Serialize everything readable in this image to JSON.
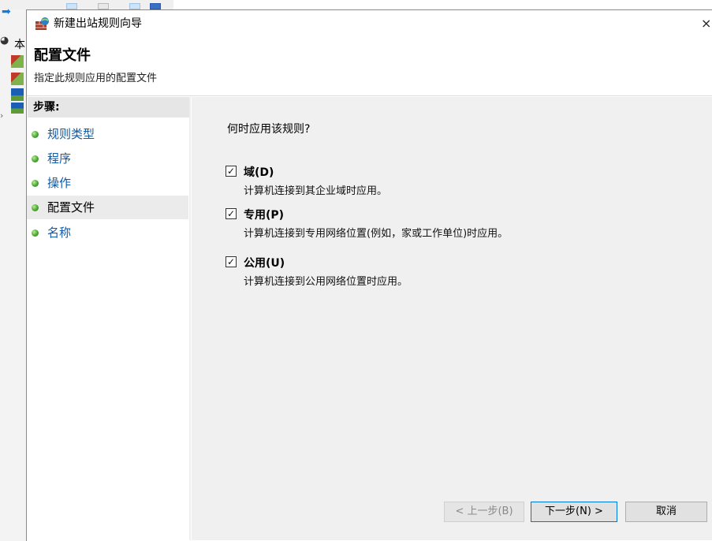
{
  "dialog": {
    "window_title": "新建出站规则向导",
    "close_glyph": "×",
    "header_title": "配置文件",
    "header_subtitle": "指定此规则应用的配置文件"
  },
  "background_app": {
    "tree_root_label": "本"
  },
  "steps": {
    "header": "步骤:",
    "items": [
      {
        "label": "规则类型",
        "state": "link"
      },
      {
        "label": "程序",
        "state": "link"
      },
      {
        "label": "操作",
        "state": "link"
      },
      {
        "label": "配置文件",
        "state": "current"
      },
      {
        "label": "名称",
        "state": "link"
      }
    ]
  },
  "content": {
    "question": "何时应用该规则?",
    "options": [
      {
        "label": "域(D)",
        "description": "计算机连接到其企业域时应用。",
        "checked": true
      },
      {
        "label": "专用(P)",
        "description": "计算机连接到专用网络位置(例如，家或工作单位)时应用。",
        "checked": true
      },
      {
        "label": "公用(U)",
        "description": "计算机连接到公用网络位置时应用。",
        "checked": true
      }
    ]
  },
  "buttons": {
    "back": "< 上一步(B)",
    "next": "下一步(N) >",
    "cancel": "取消"
  },
  "colors": {
    "link": "#0f5aa8",
    "content_bg": "#f0f0f0",
    "accent_border": "#0078d7"
  },
  "icons": {
    "window": "firewall-icon",
    "step_bullet": "green-dot-icon",
    "checkbox": "checkmark-icon"
  }
}
